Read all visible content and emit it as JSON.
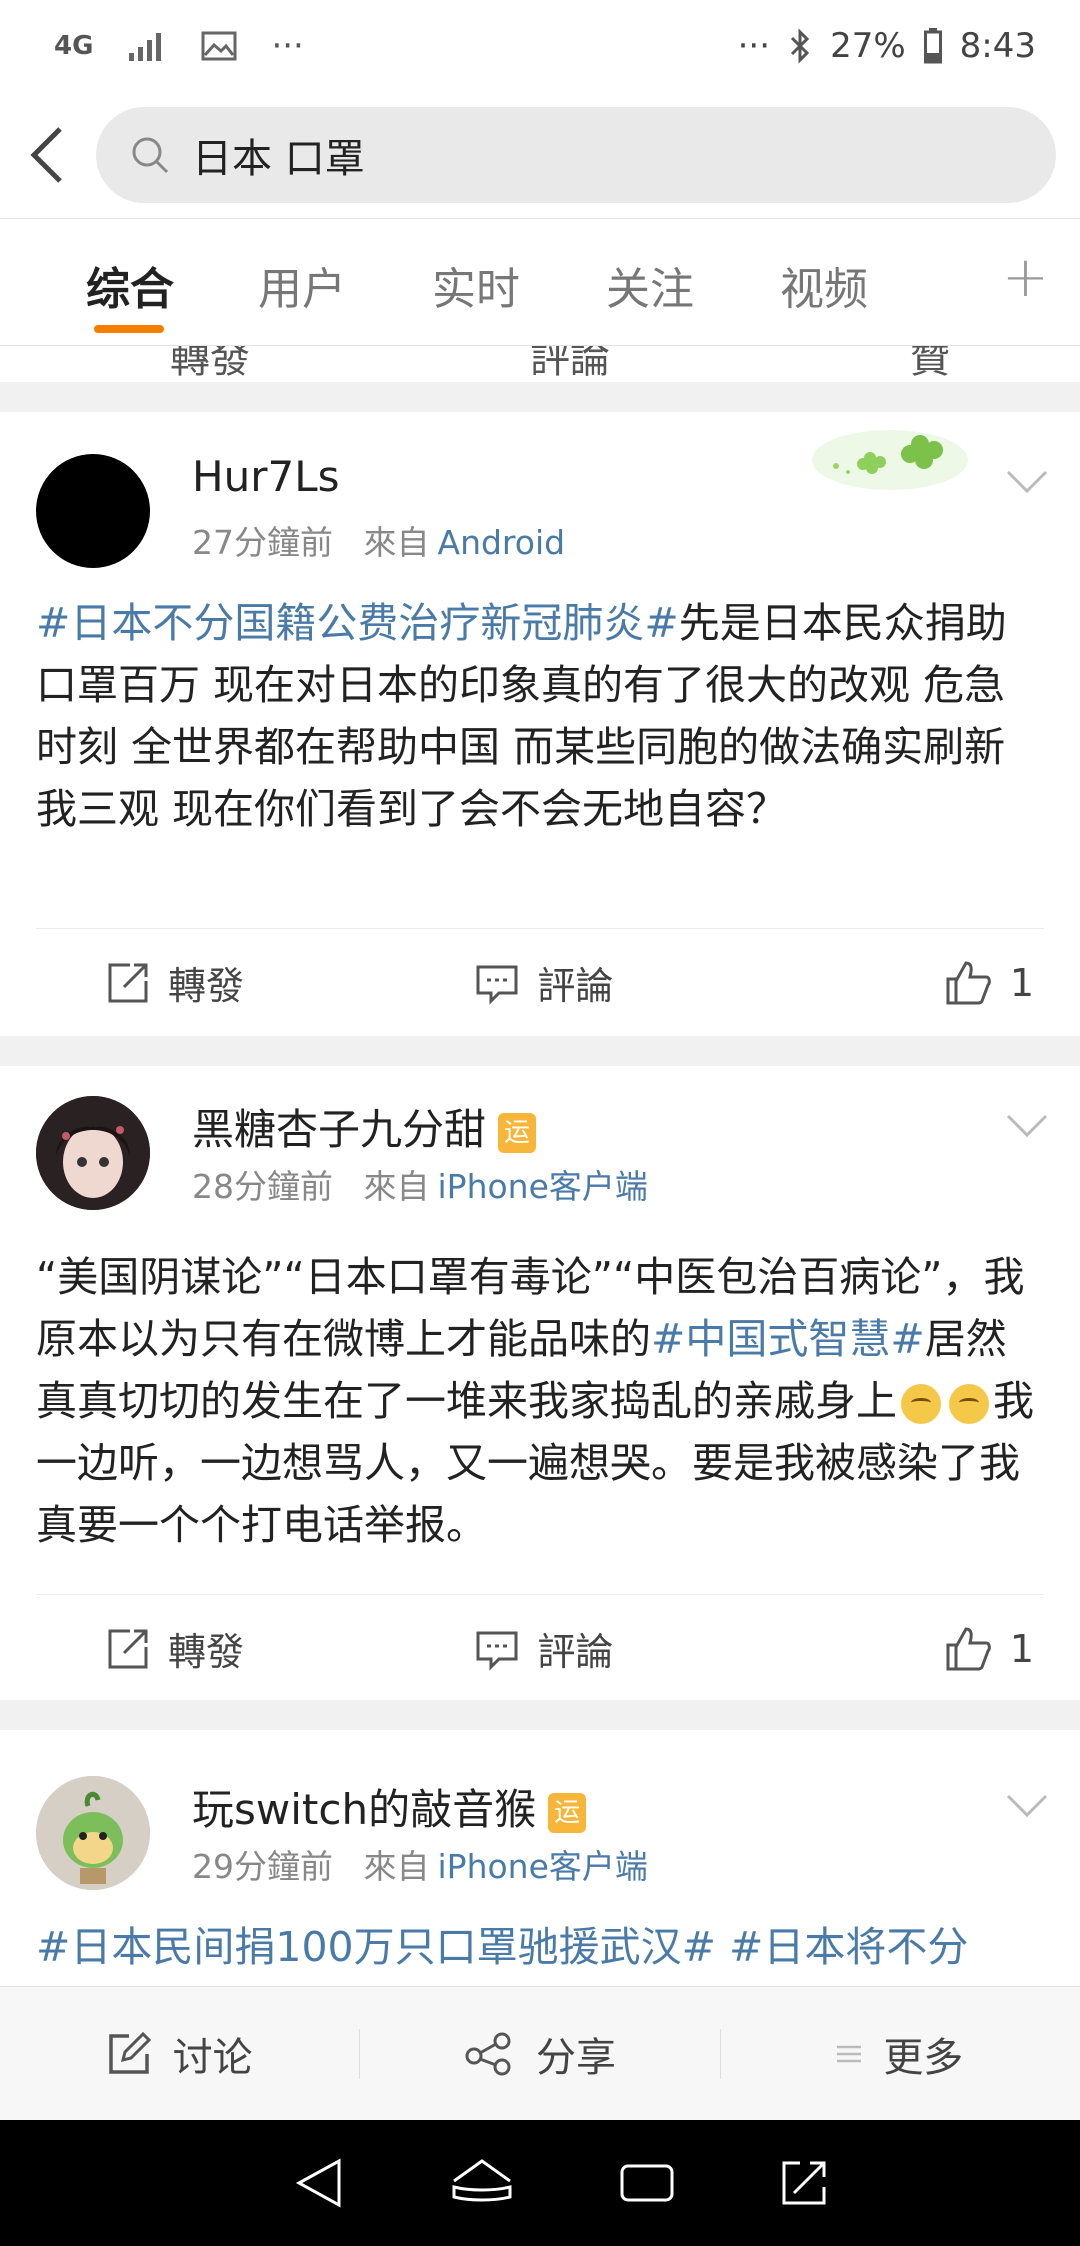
{
  "status_bar": {
    "network": "4G",
    "more_left": "···",
    "more_right": "···",
    "battery": "27%",
    "time": "8:43"
  },
  "search": {
    "query": "日本 口罩"
  },
  "tabs": [
    {
      "label": "综合"
    },
    {
      "label": "用户"
    },
    {
      "label": "实时"
    },
    {
      "label": "关注"
    },
    {
      "label": "视频"
    }
  ],
  "partial_row": {
    "repost": "轉發",
    "comment": "評論",
    "like": "贊"
  },
  "posts": [
    {
      "username": "Hur7Ls",
      "time": "27分鐘前",
      "from": "來自",
      "source": "Android",
      "hashtag": "#日本不分国籍公费治疗新冠肺炎#",
      "text": "先是日本民众捐助口罩百万 现在对日本的印象真的有了很大的改观 危急时刻 全世界都在帮助中国 而某些同胞的做法确实刷新我三观 现在你们看到了会不会无地自容？",
      "repost": "轉發",
      "comment": "評論",
      "likes": "1"
    },
    {
      "username": "黑糖杏子九分甜",
      "badge": "运",
      "time": "28分鐘前",
      "from": "來自",
      "source": "iPhone客户端",
      "text_a": "“美国阴谋论”“日本口罩有毒论”“中医包治百病论”，我原本以为只有在微博上才能品味的",
      "hashtag": "#中国式智慧#",
      "text_b": "居然真真切切的发生在了一堆来我家捣乱的亲戚身上",
      "text_c": "我一边听，一边想骂人，又一遍想哭。要是我被感染了我真要一个个打电话举报。",
      "repost": "轉發",
      "comment": "評論",
      "likes": "1"
    },
    {
      "username": "玩switch的敲音猴",
      "badge": "运",
      "time": "29分鐘前",
      "from": "來自",
      "source": "iPhone客户端",
      "hashtag_a": "#日本民间捐100万只口罩驰援武汉#",
      "hashtag_b": "#日本将不分"
    }
  ],
  "bottom_bar": {
    "discuss": "讨论",
    "share": "分享",
    "more": "更多"
  },
  "colors": {
    "accent": "#f57d00",
    "link": "#4a7ba8"
  }
}
